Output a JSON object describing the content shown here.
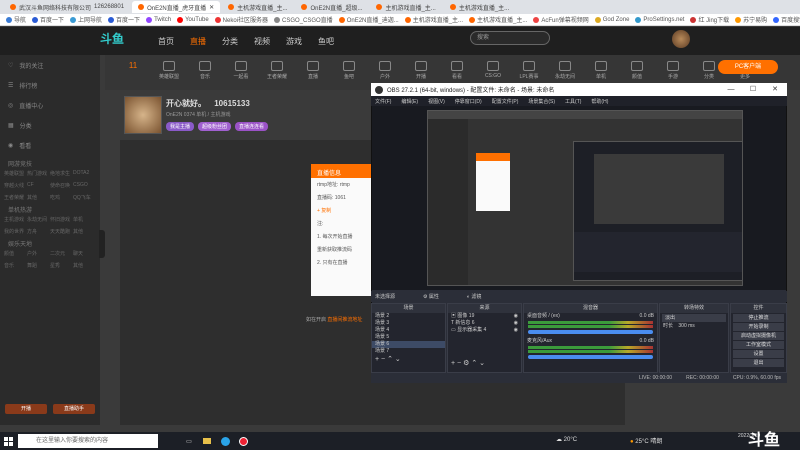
{
  "browser": {
    "tabs": [
      {
        "label": "武汉斗鱼网络科技有限公司",
        "extra": "126268801",
        "active": false
      },
      {
        "label": "OnE2N直播_虎牙直播",
        "active": true
      },
      {
        "label": "主机游戏直播_主...",
        "active": false
      },
      {
        "label": "OnE2N直播_超级...",
        "active": false
      },
      {
        "label": "主机游戏直播_主...",
        "active": false
      },
      {
        "label": "主机游戏直播_主...",
        "active": false
      }
    ],
    "bookmarks": [
      "导航",
      "百度一下",
      "上网导航",
      "百度一下",
      "Twitch",
      "YouTube",
      "Nekoi社区服务器",
      "CSGO_CSGO直播",
      "OnE2N直播_迪迦...",
      "主机游戏直播_主...",
      "主机游戏直播_主...",
      "AcFun弹幕视频网",
      "God Zone",
      "ProSettings.net",
      "红 Jing下载",
      "苏宁易购",
      "百度搜索"
    ]
  },
  "site": {
    "logo": "斗鱼",
    "nav": [
      "首页",
      "直播",
      "分类",
      "视频",
      "游戏",
      "鱼吧"
    ],
    "active_nav": "直播",
    "search_placeholder": "搜索",
    "pc_button": "PC客户端"
  },
  "sidebar": {
    "items": [
      "我的关注",
      "排行榜",
      "直播中心",
      "分类",
      "看看"
    ],
    "sections": [
      {
        "title": "网游竞技",
        "tags": [
          "英雄联盟",
          "热门游戏",
          "绝地求生",
          "DOTA2",
          "穿越火线",
          "CF",
          "使命召唤",
          "CSGO",
          "王者荣耀",
          "其他",
          "吃鸡",
          "QQ飞车"
        ]
      },
      {
        "title": "单机热游",
        "tags": [
          "主机游戏",
          "永劫无间",
          "怀旧游戏",
          "单机",
          "我的世界",
          "方舟",
          "天天酷跑",
          "其他"
        ]
      },
      {
        "title": "娱乐天地",
        "tags": [
          "颜值",
          "户外",
          "二次元",
          "聊天",
          "音乐",
          "舞蹈",
          "星秀",
          "其他"
        ]
      }
    ],
    "bottom_buttons": [
      "开播",
      "直播助手"
    ]
  },
  "categories": [
    "11",
    "英雄联盟",
    "音乐",
    "一起看",
    "王者荣耀",
    "直播",
    "鱼吧",
    "户外",
    "开播",
    "看看",
    "CS:GO",
    "LPL赛事",
    "永劫无间",
    "单机",
    "颜值",
    "手游",
    "分类",
    "更多"
  ],
  "anchor": {
    "title": "开心就好。",
    "room_id": "10615133",
    "meta": "OnE2N  0374  单机 / 主机游戏",
    "badges": [
      "我是主播",
      "超级粉丝团",
      "直播连连看"
    ]
  },
  "stage": {
    "dialog_title": "直播信息",
    "dialog_lines": [
      "rtmp地址: rtmp",
      "直播码: 1061",
      "+ 复制",
      "注:",
      "1. 每次开始直播",
      "重新获取推流码",
      "2. 只有在直播"
    ],
    "hint_prefix": "如在开启",
    "hint_link": "直播间推流地址",
    "hint_suffix": ""
  },
  "obs": {
    "title": "OBS 27.2.1 (64-bit, windows) - 配置文件: 未命名 - 场景: 未命名",
    "menu": [
      "文件(F)",
      "编辑(E)",
      "视图(V)",
      "停靠窗口(D)",
      "配置文件(P)",
      "场景集合(S)",
      "工具(T)",
      "帮助(H)"
    ],
    "scenebar": [
      "未选择源",
      "属性",
      "滤镜"
    ],
    "scenes_title": "场景",
    "scenes": [
      "场景 2",
      "场景 3",
      "场景 4",
      "场景 5",
      "场景 6",
      "场景 7"
    ],
    "selected_scene": "场景 6",
    "sources_title": "来源",
    "sources": [
      "图像 19",
      "新信息 6",
      "显示器采集 4"
    ],
    "mixer_title": "混音器",
    "mixer_tracks": [
      {
        "name": "桌面音频 / (ex)",
        "db": "0.0 dB"
      },
      {
        "name": "麦克风/Aux",
        "db": "0.0 dB"
      }
    ],
    "transitions_title": "转场特效",
    "transition_type": "淡出",
    "transition_duration_label": "时长",
    "transition_duration": "300 ms",
    "controls_title": "控件",
    "controls": [
      "停止推流",
      "开始录制",
      "启动虚拟摄像机",
      "工作室模式",
      "设置",
      "退出"
    ],
    "status": [
      "LIVE: 00:00:00",
      "REC: 00:00:00",
      "CPU: 0.9%, 60.00 fps"
    ]
  },
  "taskbar": {
    "search": "在这里输入你要搜索的内容",
    "weather1": "20°C",
    "weather2": "25°C  晴朗",
    "time": "",
    "date": "2022/3/19",
    "watermark": "斗鱼"
  },
  "colors": {
    "brand_orange": "#ff7000",
    "obs_bg": "#2b2e38",
    "douyu_bg": "#2b2b2b"
  }
}
